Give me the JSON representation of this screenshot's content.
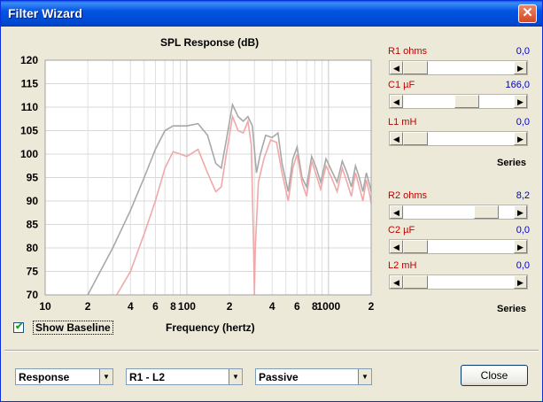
{
  "window": {
    "title": "Filter Wizard",
    "close_glyph": "✕"
  },
  "chart_data": {
    "type": "line",
    "title": "SPL Response (dB)",
    "xlabel": "Frequency (hertz)",
    "ylabel": "",
    "x_scale": "log",
    "xlim": [
      10,
      2000
    ],
    "ylim": [
      70,
      120
    ],
    "y_ticks": [
      70,
      75,
      80,
      85,
      90,
      95,
      100,
      105,
      110,
      115,
      120
    ],
    "x_tick_labels": [
      {
        "f": 10,
        "label": "10"
      },
      {
        "f": 20,
        "label": "2"
      },
      {
        "f": 40,
        "label": "4"
      },
      {
        "f": 60,
        "label": "6"
      },
      {
        "f": 80,
        "label": "8"
      },
      {
        "f": 100,
        "label": "100"
      },
      {
        "f": 200,
        "label": "2"
      },
      {
        "f": 400,
        "label": "4"
      },
      {
        "f": 600,
        "label": "6"
      },
      {
        "f": 800,
        "label": "8"
      },
      {
        "f": 1000,
        "label": "1000"
      },
      {
        "f": 2000,
        "label": "2"
      }
    ],
    "grid": true,
    "series": [
      {
        "color": "#A8A8A8",
        "points": [
          [
            20,
            70
          ],
          [
            30,
            80
          ],
          [
            40,
            88
          ],
          [
            50,
            95
          ],
          [
            60,
            101
          ],
          [
            70,
            105
          ],
          [
            80,
            106
          ],
          [
            100,
            106
          ],
          [
            120,
            106.5
          ],
          [
            140,
            104
          ],
          [
            160,
            98
          ],
          [
            175,
            97
          ],
          [
            190,
            103
          ],
          [
            210,
            110.5
          ],
          [
            230,
            108
          ],
          [
            250,
            107
          ],
          [
            270,
            108
          ],
          [
            290,
            106
          ],
          [
            310,
            96
          ],
          [
            330,
            100
          ],
          [
            360,
            104
          ],
          [
            400,
            103.5
          ],
          [
            440,
            104.5
          ],
          [
            470,
            98
          ],
          [
            520,
            92
          ],
          [
            560,
            99
          ],
          [
            600,
            101.5
          ],
          [
            650,
            95
          ],
          [
            700,
            93
          ],
          [
            760,
            99.5
          ],
          [
            820,
            97
          ],
          [
            880,
            94
          ],
          [
            960,
            99
          ],
          [
            1050,
            96.5
          ],
          [
            1150,
            94
          ],
          [
            1250,
            98.5
          ],
          [
            1350,
            96
          ],
          [
            1450,
            93
          ],
          [
            1550,
            97.5
          ],
          [
            1650,
            95
          ],
          [
            1750,
            92
          ],
          [
            1850,
            96
          ],
          [
            1950,
            93.5
          ],
          [
            2000,
            92
          ]
        ]
      },
      {
        "color": "#F0A8A8",
        "points": [
          [
            32,
            70
          ],
          [
            40,
            75
          ],
          [
            50,
            83
          ],
          [
            60,
            90
          ],
          [
            70,
            97
          ],
          [
            80,
            100.5
          ],
          [
            90,
            100
          ],
          [
            100,
            99.5
          ],
          [
            120,
            101
          ],
          [
            140,
            96
          ],
          [
            160,
            92
          ],
          [
            175,
            93
          ],
          [
            190,
            100
          ],
          [
            210,
            108
          ],
          [
            230,
            105
          ],
          [
            250,
            104.5
          ],
          [
            270,
            107
          ],
          [
            285,
            102
          ],
          [
            296,
            80
          ],
          [
            300,
            70
          ],
          [
            304,
            80
          ],
          [
            320,
            94
          ],
          [
            350,
            99
          ],
          [
            390,
            103
          ],
          [
            430,
            102.5
          ],
          [
            470,
            96
          ],
          [
            520,
            90
          ],
          [
            560,
            97
          ],
          [
            600,
            100
          ],
          [
            650,
            94
          ],
          [
            700,
            91
          ],
          [
            760,
            98.5
          ],
          [
            820,
            95.5
          ],
          [
            880,
            92.5
          ],
          [
            960,
            97.5
          ],
          [
            1050,
            95
          ],
          [
            1150,
            92
          ],
          [
            1250,
            97
          ],
          [
            1350,
            94
          ],
          [
            1450,
            91
          ],
          [
            1550,
            96
          ],
          [
            1650,
            93
          ],
          [
            1750,
            90
          ],
          [
            1850,
            94.5
          ],
          [
            1950,
            91.5
          ],
          [
            2000,
            89.5
          ]
        ]
      }
    ]
  },
  "controls": {
    "show_baseline_label": "Show Baseline",
    "show_baseline_checked": true,
    "check_glyph": "✔",
    "sliders": [
      {
        "label": "R1  ohms",
        "value": "0,0",
        "position": 0.0
      },
      {
        "label": "C1  µF",
        "value": "166,0",
        "position": 0.6
      },
      {
        "label": "L1  mH",
        "value": "0,0",
        "position": 0.0
      },
      {
        "label": "R2  ohms",
        "value": "8,2",
        "position": 0.82
      },
      {
        "label": "C2  µF",
        "value": "0,0",
        "position": 0.0
      },
      {
        "label": "L2  mH",
        "value": "0,0",
        "position": 0.0
      }
    ],
    "series_label_1": "Series",
    "series_label_2": "Series",
    "arrow_left": "◀",
    "arrow_right": "▶"
  },
  "footer": {
    "mode_select": "Response",
    "component_select": "R1 - L2",
    "type_select": "Passive",
    "dropdown_glyph": "▼",
    "close_button": "Close"
  }
}
